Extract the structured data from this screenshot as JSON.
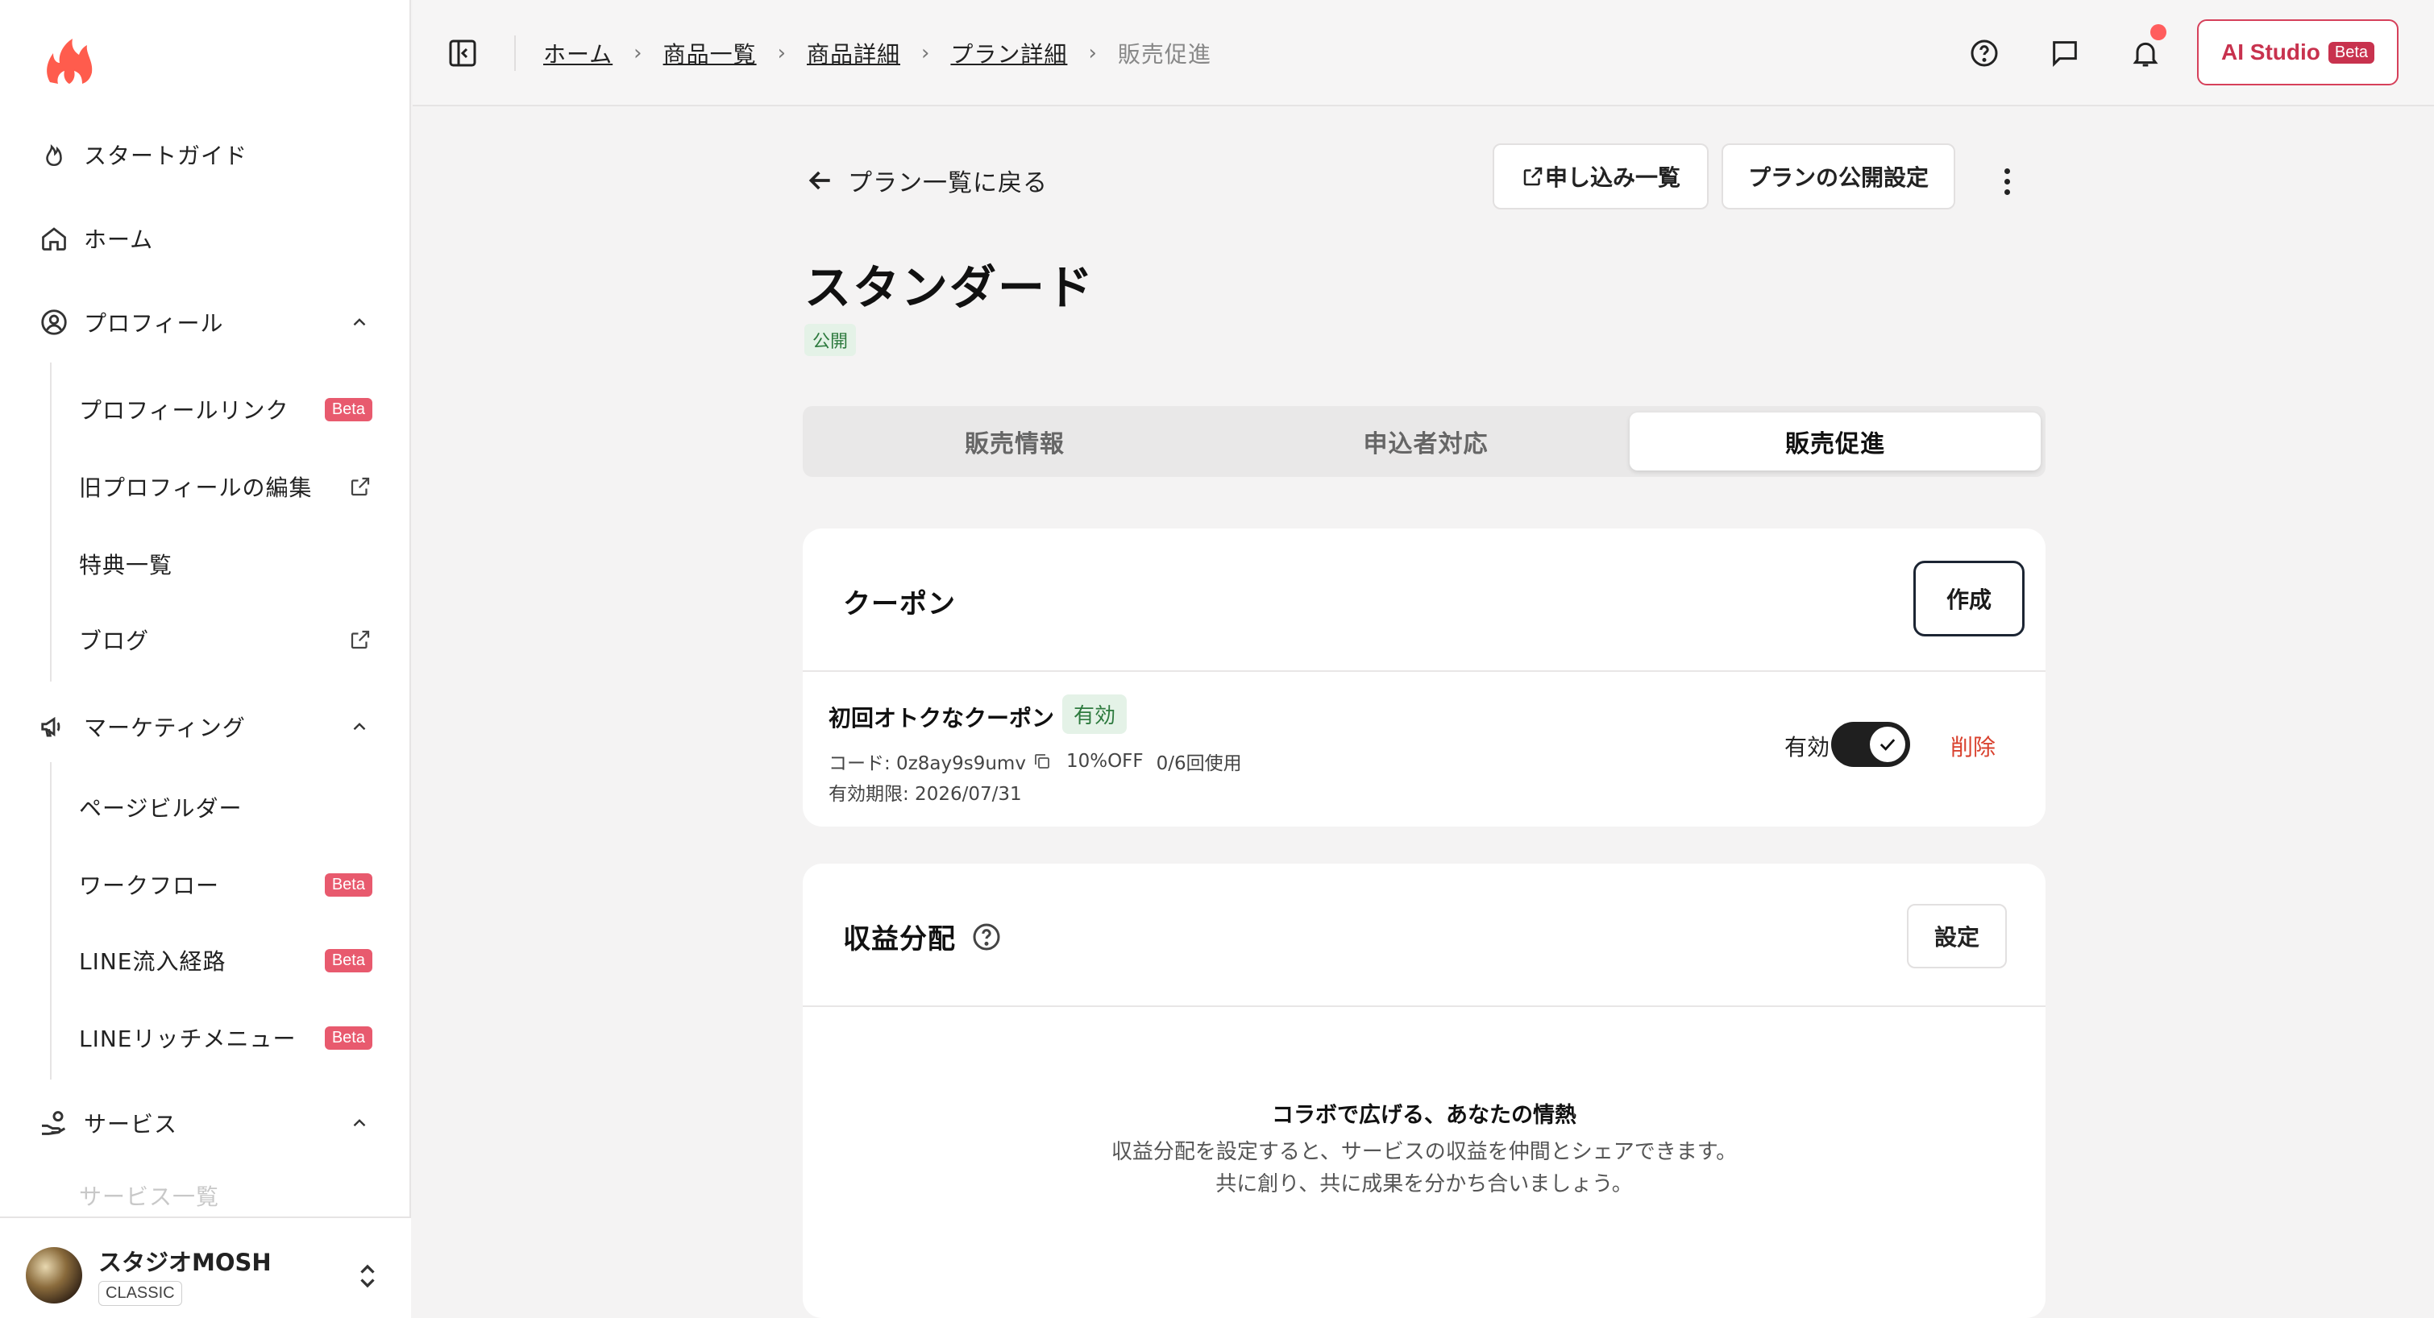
{
  "sidebar": {
    "items": [
      {
        "label": "スタートガイド",
        "icon": "flame-icon"
      },
      {
        "label": "ホーム",
        "icon": "home-icon"
      },
      {
        "label": "プロフィール",
        "icon": "user-circle-icon"
      },
      {
        "label": "マーケティング",
        "icon": "megaphone-icon"
      },
      {
        "label": "サービス",
        "icon": "hand-coin-icon"
      }
    ],
    "profile_sub": [
      {
        "label": "プロフィールリンク",
        "badge": "Beta"
      },
      {
        "label": "旧プロフィールの編集",
        "icon": "external-link-icon"
      },
      {
        "label": "特典一覧"
      },
      {
        "label": "ブログ",
        "icon": "external-link-icon"
      }
    ],
    "marketing_sub": [
      {
        "label": "ページビルダー"
      },
      {
        "label": "ワークフロー",
        "badge": "Beta"
      },
      {
        "label": "LINE流入経路",
        "badge": "Beta"
      },
      {
        "label": "LINEリッチメニュー",
        "badge": "Beta"
      }
    ],
    "service_sub": [
      {
        "label": "サービス一覧"
      }
    ],
    "account": {
      "name": "スタジオMOSH",
      "plan": "CLASSIC"
    }
  },
  "topbar": {
    "breadcrumb": [
      "ホーム",
      "商品一覧",
      "商品詳細",
      "プラン詳細",
      "販売促進"
    ],
    "ai_studio_label": "AI Studio",
    "ai_studio_badge": "Beta"
  },
  "header": {
    "back_label": "プラン一覧に戻る",
    "applications_label": "申し込み一覧",
    "publish_settings_label": "プランの公開設定",
    "title": "スタンダード",
    "status": "公開"
  },
  "tabs": [
    {
      "label": "販売情報",
      "active": false
    },
    {
      "label": "申込者対応",
      "active": false
    },
    {
      "label": "販売促進",
      "active": true
    }
  ],
  "coupon_card": {
    "title": "クーポン",
    "create_label": "作成",
    "coupon": {
      "name": "初回オトクなクーポン",
      "status": "有効",
      "code": "コード: 0z8ay9s9umv",
      "discount": "10%OFF",
      "usage": "0/6回使用",
      "expiry": "有効期限: 2026/07/31",
      "toggle_label": "有効",
      "enabled": true,
      "delete_label": "削除"
    }
  },
  "revenue_card": {
    "title": "収益分配",
    "settings_label": "設定",
    "empty_title": "コラボで広げる、あなたの情熱",
    "empty_line1": "収益分配を設定すると、サービスの収益を仲間とシェアできます。",
    "empty_line2": "共に創り、共に成果を分かち合いましょう。"
  },
  "colors": {
    "accent": "#c8324e",
    "beta": "#e85a6e",
    "success_bg": "#e4f2e7",
    "success_text": "#2d7a3e",
    "danger": "#d9412e"
  }
}
